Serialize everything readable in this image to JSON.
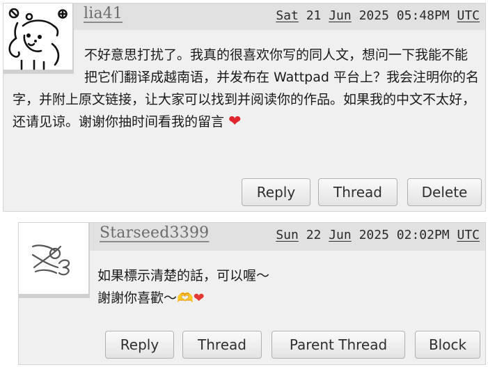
{
  "comments": [
    {
      "username": "lia41",
      "date": {
        "weekday": "Sat",
        "day": "21",
        "month": "Jun",
        "year": "2025",
        "time": "05:48PM",
        "tz": "UTC"
      },
      "body": "不好意思打扰了。我真的很喜欢你写的同人文，想问一下我能不能把它们翻译成越南语，并发布在 Wattpad 平台上？我会注明你的名字，并附上原文链接，让大家可以找到并阅读你的作品。如果我的中文不太好，还请见谅。谢谢你抽时间看我的留言",
      "emoji": "❤",
      "buttons": [
        "Reply",
        "Thread",
        "Delete"
      ]
    },
    {
      "username": "Starseed3399",
      "date": {
        "weekday": "Sun",
        "day": "22",
        "month": "Jun",
        "year": "2025",
        "time": "02:02PM",
        "tz": "UTC"
      },
      "body_line1": "如果標示清楚的話，可以喔～",
      "body_line2": "謝謝你喜歡～",
      "emoji_hands": "🫶",
      "emoji_heart": "❤",
      "buttons": [
        "Reply",
        "Thread",
        "Parent Thread",
        "Block"
      ]
    }
  ]
}
